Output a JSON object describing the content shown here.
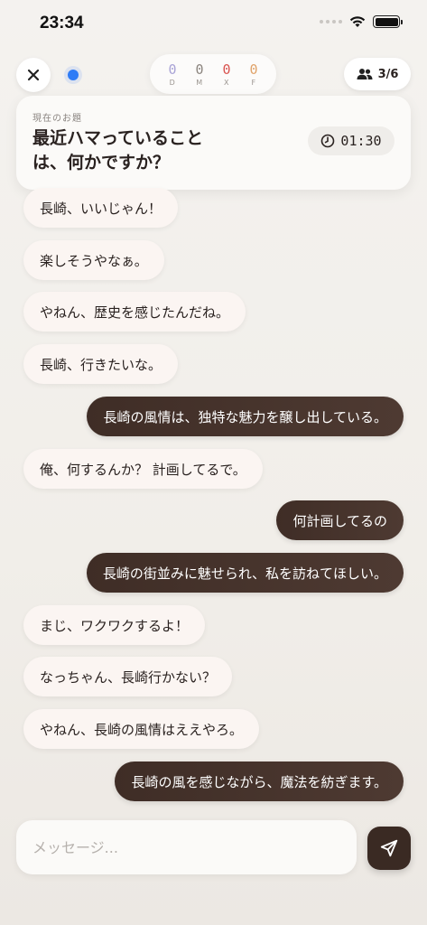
{
  "status_bar": {
    "time": "23:34"
  },
  "scores": [
    {
      "label": "D",
      "value": "0",
      "color": "#a9a3d6"
    },
    {
      "label": "M",
      "value": "0",
      "color": "#8c857f"
    },
    {
      "label": "X",
      "value": "0",
      "color": "#d9534f"
    },
    {
      "label": "F",
      "value": "0",
      "color": "#e0a36a"
    }
  ],
  "players": "3/6",
  "topic": {
    "label": "現在のお題",
    "text": "最近ハマっていることは、何かですか？",
    "timer": "01:30"
  },
  "messages": [
    {
      "side": "in",
      "text": "長崎、いいじゃん！"
    },
    {
      "side": "in",
      "text": "楽しそうやなぁ。"
    },
    {
      "side": "in",
      "text": "やねん、歴史を感じたんだね。"
    },
    {
      "side": "in",
      "text": "長崎、行きたいな。"
    },
    {
      "side": "out",
      "text": "長崎の風情は、独特な魅力を醸し出している。"
    },
    {
      "side": "in",
      "text": "俺、何するんか？ 計画してるで。"
    },
    {
      "side": "out",
      "text": "何計画してるの"
    },
    {
      "side": "out",
      "text": "長崎の街並みに魅せられ、私を訪ねてほしい。"
    },
    {
      "side": "in",
      "text": "まじ、ワクワクするよ！"
    },
    {
      "side": "in",
      "text": "なっちゃん、長崎行かない？"
    },
    {
      "side": "in",
      "text": "やねん、長崎の風情はええやろ。"
    },
    {
      "side": "out",
      "text": "長崎の風を感じながら、魔法を紡ぎます。"
    }
  ],
  "input": {
    "placeholder": "メッセージ..."
  }
}
